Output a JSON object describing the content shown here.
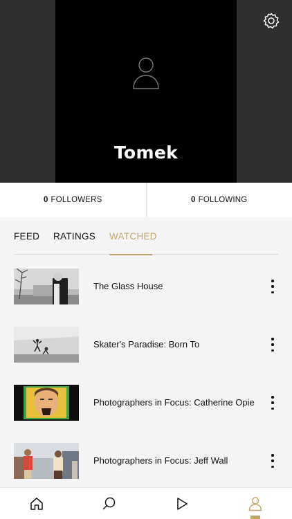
{
  "profile": {
    "name": "Tomek",
    "avatar_icon": "person-icon",
    "settings_icon": "gear-icon"
  },
  "stats": {
    "followers_count": "0",
    "followers_label": "FOLLOWERS",
    "following_count": "0",
    "following_label": "FOLLOWING"
  },
  "tabs": [
    {
      "label": "FEED",
      "active": false
    },
    {
      "label": "RATINGS",
      "active": false
    },
    {
      "label": "WATCHED",
      "active": true
    }
  ],
  "items": [
    {
      "title": "The Glass House"
    },
    {
      "title": "Skater's Paradise: Born To"
    },
    {
      "title": "Photographers in Focus: Catherine Opie"
    },
    {
      "title": "Photographers in Focus: Jeff Wall"
    }
  ],
  "tabbar": {
    "items": [
      "home-icon",
      "search-icon",
      "play-icon",
      "profile-icon"
    ],
    "active": "profile-icon"
  },
  "colors": {
    "accent": "#c0a46a",
    "hero_bg": "#2f2f2f",
    "page_bg": "#f5f5f5"
  }
}
